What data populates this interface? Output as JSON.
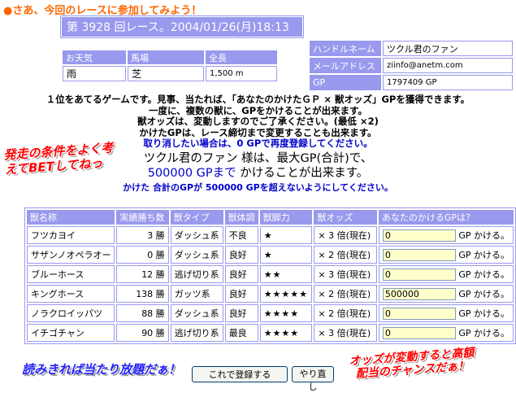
{
  "heading": {
    "bullet": "●",
    "text": "さあ、今回のレースに参加してみよう！"
  },
  "race": {
    "title": "第 3928 回レース。2004/01/26(月)18:13"
  },
  "conditions": {
    "headers": [
      "お天気",
      "馬場",
      "全長"
    ],
    "values": [
      "雨",
      "芝",
      "1,500 m"
    ]
  },
  "user": {
    "handle_label": "ハンドルネーム",
    "handle": "ツクル君のファン",
    "email_label": "メールアドレス",
    "email": "ziinfo@anetm.com",
    "gp_label": "GP",
    "gp": "1797409 GP"
  },
  "rules": {
    "line1": "１位をあてるゲームです。見事、当たれば、「あなたのかけたＧＰ × 獣オッズ」GPを獲得できます。",
    "line2": "一度に、複数の獣に、GPをかけることが出来ます。",
    "line3": "獣オッズは、変動しますのでご了承ください。(最低 ×2)",
    "line4": "かけたGPは、レース締切まで変更することも出来ます。",
    "line5": "取り消したい場合は、0 GPで再度登録してください。"
  },
  "user_line": {
    "name": "ツクル君のファン",
    "mid": " 様は、最大GP(合計)で、",
    "max_gp": "500000 GPまで",
    "tail": " かけることが出来ます。"
  },
  "warning": "かけた 合計のGPが 500000 GPを超えないようにしてください。",
  "callouts": {
    "left_line1": "発走の条件をよく考",
    "left_line2": "えてBETしてねっ",
    "right_line1": "オッズが変動すると高額",
    "right_line2": "配当のチャンスだぁ！",
    "bottom_left": "読みきれば当たり放題だぁ！"
  },
  "horse_table": {
    "headers": [
      "獣名称",
      "実績勝ち数",
      "獣タイプ",
      "獣体調",
      "獣脚力",
      "獣オッズ",
      "あなたのかけるGPは？"
    ],
    "gp_suffix": "GP かける。",
    "rows": [
      {
        "name": "フツカヨイ",
        "wins": "3 勝",
        "type": "ダッシュ系",
        "condition": "不良",
        "power": "★",
        "odds": "× 3 倍(現在)",
        "bet": "0"
      },
      {
        "name": "サザンノオペラオー",
        "wins": "0 勝",
        "type": "ダッシュ系",
        "condition": "良好",
        "power": "★",
        "odds": "× 2 倍(現在)",
        "bet": "0"
      },
      {
        "name": "ブルーホース",
        "wins": "12 勝",
        "type": "逃げ切り系",
        "condition": "良好",
        "power": "★★",
        "odds": "× 3 倍(現在)",
        "bet": "0"
      },
      {
        "name": "キングホース",
        "wins": "138 勝",
        "type": "ガッツ系",
        "condition": "良好",
        "power": "★★★★★",
        "odds": "× 2 倍(現在)",
        "bet": "500000"
      },
      {
        "name": "ノラクロイッパツ",
        "wins": "88 勝",
        "type": "ダッシュ系",
        "condition": "良好",
        "power": "★★★★",
        "odds": "× 2 倍(現在)",
        "bet": "0"
      },
      {
        "name": "イチゴチャン",
        "wins": "90 勝",
        "type": "逃げ切り系",
        "condition": "最良",
        "power": "★★★★",
        "odds": "× 3 倍(現在)",
        "bet": "0"
      }
    ]
  },
  "buttons": {
    "register": "これで登録する",
    "reset": "やり直し"
  }
}
